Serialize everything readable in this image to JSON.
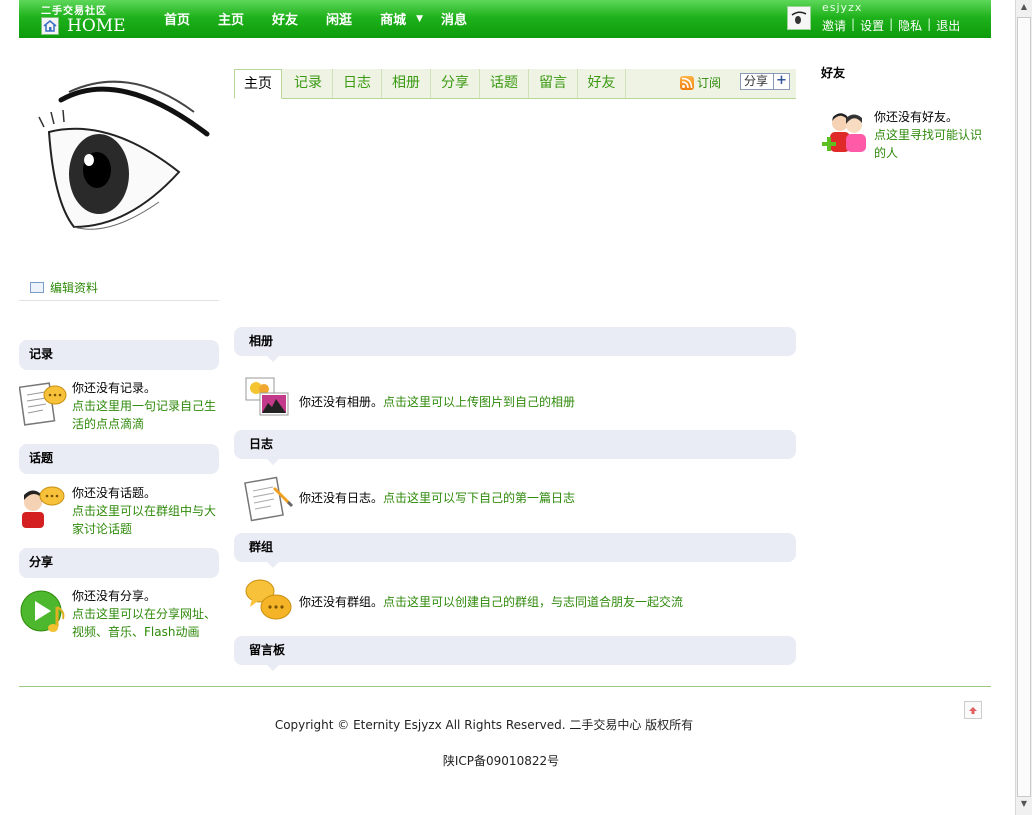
{
  "header": {
    "logo_cn": "二手交易社区",
    "logo_en": "HOME",
    "nav": [
      "首页",
      "主页",
      "好友",
      "闲逛",
      "商城",
      "消息"
    ],
    "username": "esjyzx",
    "user_links": [
      "邀请",
      "设置",
      "隐私",
      "退出"
    ]
  },
  "profile": {
    "edit_label": "编辑资料"
  },
  "left_boxes": [
    {
      "title": "记录",
      "empty": "你还没有记录。",
      "link": "点击这里用一句记录自己生活的点点滴滴"
    },
    {
      "title": "话题",
      "empty": "你还没有话题。",
      "link": "点击这里可以在群组中与大家讨论话题"
    },
    {
      "title": "分享",
      "empty": "你还没有分享。",
      "link": "点击这里可以在分享网址、视频、音乐、Flash动画"
    }
  ],
  "tabs": [
    "主页",
    "记录",
    "日志",
    "相册",
    "分享",
    "话题",
    "留言",
    "好友"
  ],
  "subscribe_label": "订阅",
  "share_label": "分享",
  "sections": [
    {
      "title": "相册",
      "empty": "你还没有相册。",
      "link": "点击这里可以上传图片到自己的相册"
    },
    {
      "title": "日志",
      "empty": "你还没有日志。",
      "link": "点击这里可以写下自己的第一篇日志"
    },
    {
      "title": "群组",
      "empty": "你还没有群组。",
      "link": "点击这里可以创建自己的群组，与志同道合朋友一起交流"
    },
    {
      "title": "留言板"
    }
  ],
  "friends": {
    "title": "好友",
    "empty": "你还没有好友。",
    "link": "点这里寻找可能认识的人"
  },
  "footer": {
    "copyright": "Copyright © Eternity Esjyzx All Rights Reserved. 二手交易中心 版权所有",
    "icp": "陕ICP备09010822号"
  }
}
